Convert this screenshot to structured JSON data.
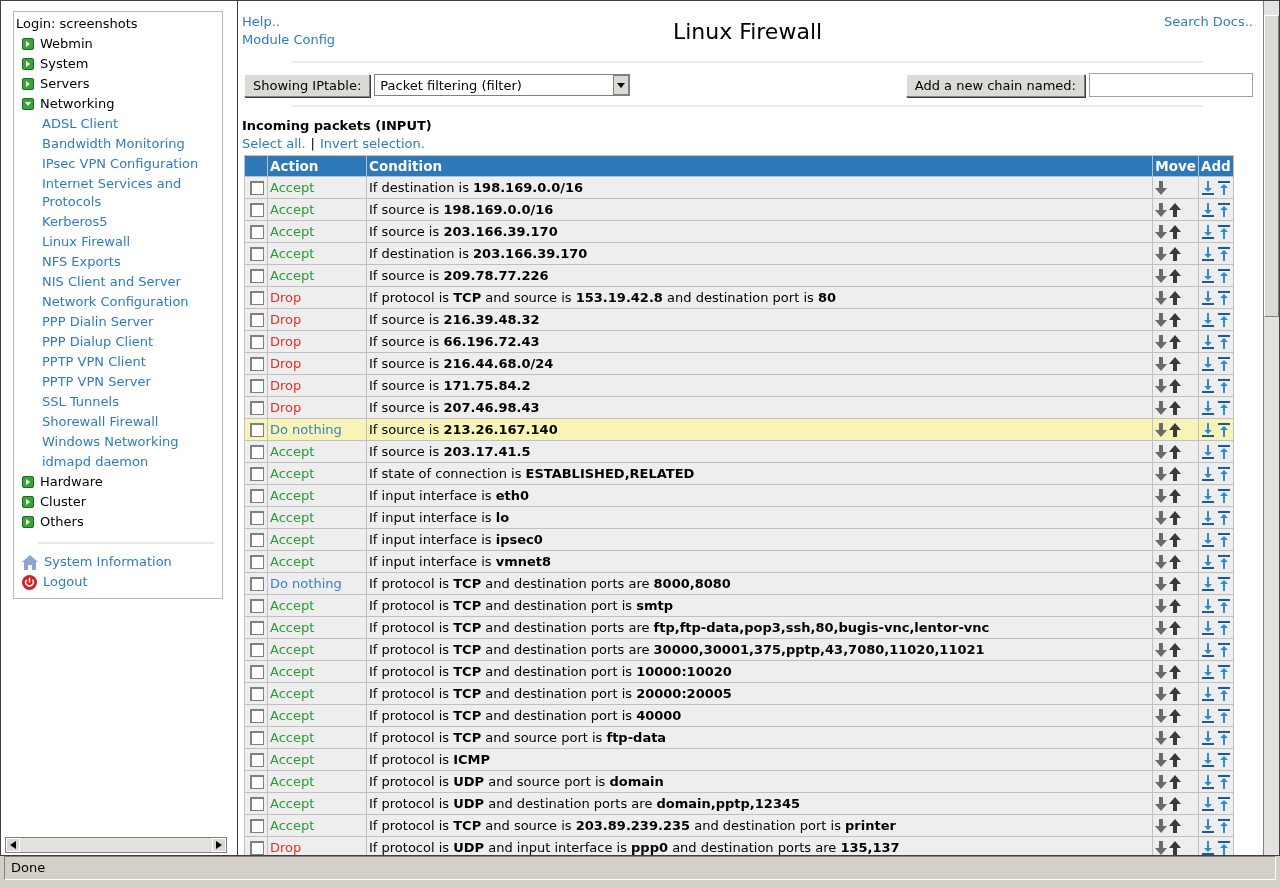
{
  "sidebar": {
    "login": "Login: screenshots",
    "categories": [
      {
        "label": "Webmin",
        "expanded": false
      },
      {
        "label": "System",
        "expanded": false
      },
      {
        "label": "Servers",
        "expanded": false
      },
      {
        "label": "Networking",
        "expanded": true,
        "children": [
          "ADSL Client",
          "Bandwidth Monitoring",
          "IPsec VPN Configuration",
          "Internet Services and Protocols",
          "Kerberos5",
          "Linux Firewall",
          "NFS Exports",
          "NIS Client and Server",
          "Network Configuration",
          "PPP Dialin Server",
          "PPP Dialup Client",
          "PPTP VPN Client",
          "PPTP VPN Server",
          "SSL Tunnels",
          "Shorewall Firewall",
          "Windows Networking",
          "idmapd daemon"
        ]
      },
      {
        "label": "Hardware",
        "expanded": false
      },
      {
        "label": "Cluster",
        "expanded": false
      },
      {
        "label": "Others",
        "expanded": false
      }
    ],
    "links": [
      {
        "kind": "home",
        "label": "System Information"
      },
      {
        "kind": "logout",
        "label": "Logout"
      }
    ]
  },
  "header": {
    "links": [
      "Help..",
      "Module Config"
    ],
    "title": "Linux Firewall",
    "search_link": "Search Docs.."
  },
  "toolbar": {
    "table_button": "Showing IPtable:",
    "table_select": "Packet filtering (filter)",
    "chain_button": "Add a new chain named:"
  },
  "chain": {
    "title": "Incoming packets (INPUT)",
    "select_all": "Select all.",
    "separator": "|",
    "invert": "Invert selection.",
    "columns": [
      "Action",
      "Condition",
      "Move",
      "Add"
    ],
    "rows": [
      {
        "action": "Accept",
        "kind": "accept",
        "condition": "If destination is **198.169.0.0/16**",
        "checked": false,
        "highlighted": false,
        "move_up": false
      },
      {
        "action": "Accept",
        "kind": "accept",
        "condition": "If source is **198.169.0.0/16**",
        "checked": false,
        "highlighted": false,
        "move_up": true
      },
      {
        "action": "Accept",
        "kind": "accept",
        "condition": "If source is **203.166.39.170**",
        "checked": false,
        "highlighted": false,
        "move_up": true
      },
      {
        "action": "Accept",
        "kind": "accept",
        "condition": "If destination is **203.166.39.170**",
        "checked": false,
        "highlighted": false,
        "move_up": true
      },
      {
        "action": "Accept",
        "kind": "accept",
        "condition": "If source is **209.78.77.226**",
        "checked": false,
        "highlighted": false,
        "move_up": true
      },
      {
        "action": "Drop",
        "kind": "drop",
        "condition": "If protocol is **TCP** and source is **153.19.42.8** and destination port is **80**",
        "checked": false,
        "highlighted": false,
        "move_up": true
      },
      {
        "action": "Drop",
        "kind": "drop",
        "condition": "If source is **216.39.48.32**",
        "checked": false,
        "highlighted": false,
        "move_up": true
      },
      {
        "action": "Drop",
        "kind": "drop",
        "condition": "If source is **66.196.72.43**",
        "checked": false,
        "highlighted": false,
        "move_up": true
      },
      {
        "action": "Drop",
        "kind": "drop",
        "condition": "If source is **216.44.68.0/24**",
        "checked": false,
        "highlighted": false,
        "move_up": true
      },
      {
        "action": "Drop",
        "kind": "drop",
        "condition": "If source is **171.75.84.2**",
        "checked": false,
        "highlighted": false,
        "move_up": true
      },
      {
        "action": "Drop",
        "kind": "drop",
        "condition": "If source is **207.46.98.43**",
        "checked": false,
        "highlighted": false,
        "move_up": true
      },
      {
        "action": "Do nothing",
        "kind": "none",
        "condition": "If source is **213.26.167.140**",
        "checked": false,
        "highlighted": true,
        "move_up": true
      },
      {
        "action": "Accept",
        "kind": "accept",
        "condition": "If source is **203.17.41.5**",
        "checked": false,
        "highlighted": false,
        "move_up": true
      },
      {
        "action": "Accept",
        "kind": "accept",
        "condition": "If state of connection is **ESTABLISHED,RELATED**",
        "checked": false,
        "highlighted": false,
        "move_up": true
      },
      {
        "action": "Accept",
        "kind": "accept",
        "condition": "If input interface is **eth0**",
        "checked": false,
        "highlighted": false,
        "move_up": true
      },
      {
        "action": "Accept",
        "kind": "accept",
        "condition": "If input interface is **lo**",
        "checked": false,
        "highlighted": false,
        "move_up": true
      },
      {
        "action": "Accept",
        "kind": "accept",
        "condition": "If input interface is **ipsec0**",
        "checked": false,
        "highlighted": false,
        "move_up": true
      },
      {
        "action": "Accept",
        "kind": "accept",
        "condition": "If input interface is **vmnet8**",
        "checked": false,
        "highlighted": false,
        "move_up": true
      },
      {
        "action": "Do nothing",
        "kind": "none",
        "condition": "If protocol is **TCP** and destination ports are **8000,8080**",
        "checked": false,
        "highlighted": false,
        "move_up": true
      },
      {
        "action": "Accept",
        "kind": "accept",
        "condition": "If protocol is **TCP** and destination port is **smtp**",
        "checked": false,
        "highlighted": false,
        "move_up": true
      },
      {
        "action": "Accept",
        "kind": "accept",
        "condition": "If protocol is **TCP** and destination ports are **ftp,ftp-data,pop3,ssh,80,bugis-vnc,lentor-vnc**",
        "checked": false,
        "highlighted": false,
        "move_up": true
      },
      {
        "action": "Accept",
        "kind": "accept",
        "condition": "If protocol is **TCP** and destination ports are **30000,30001,375,pptp,43,7080,11020,11021**",
        "checked": false,
        "highlighted": false,
        "move_up": true
      },
      {
        "action": "Accept",
        "kind": "accept",
        "condition": "If protocol is **TCP** and destination port is **10000:10020**",
        "checked": false,
        "highlighted": false,
        "move_up": true
      },
      {
        "action": "Accept",
        "kind": "accept",
        "condition": "If protocol is **TCP** and destination port is **20000:20005**",
        "checked": false,
        "highlighted": false,
        "move_up": true
      },
      {
        "action": "Accept",
        "kind": "accept",
        "condition": "If protocol is **TCP** and destination port is **40000**",
        "checked": false,
        "highlighted": false,
        "move_up": true
      },
      {
        "action": "Accept",
        "kind": "accept",
        "condition": "If protocol is **TCP** and source port is **ftp-data**",
        "checked": false,
        "highlighted": false,
        "move_up": true
      },
      {
        "action": "Accept",
        "kind": "accept",
        "condition": "If protocol is **ICMP**",
        "checked": false,
        "highlighted": false,
        "move_up": true
      },
      {
        "action": "Accept",
        "kind": "accept",
        "condition": "If protocol is **UDP** and source port is **domain**",
        "checked": false,
        "highlighted": false,
        "move_up": true
      },
      {
        "action": "Accept",
        "kind": "accept",
        "condition": "If protocol is **UDP** and destination ports are **domain,pptp,12345**",
        "checked": false,
        "highlighted": false,
        "move_up": true
      },
      {
        "action": "Accept",
        "kind": "accept",
        "condition": "If protocol is **TCP** and source is **203.89.239.235** and destination port is **printer**",
        "checked": false,
        "highlighted": false,
        "move_up": true
      },
      {
        "action": "Drop",
        "kind": "drop",
        "condition": "If protocol is **UDP** and input interface is **ppp0** and destination ports are **135,137**",
        "checked": false,
        "highlighted": false,
        "move_up": true
      }
    ]
  },
  "status_bar": "Done"
}
